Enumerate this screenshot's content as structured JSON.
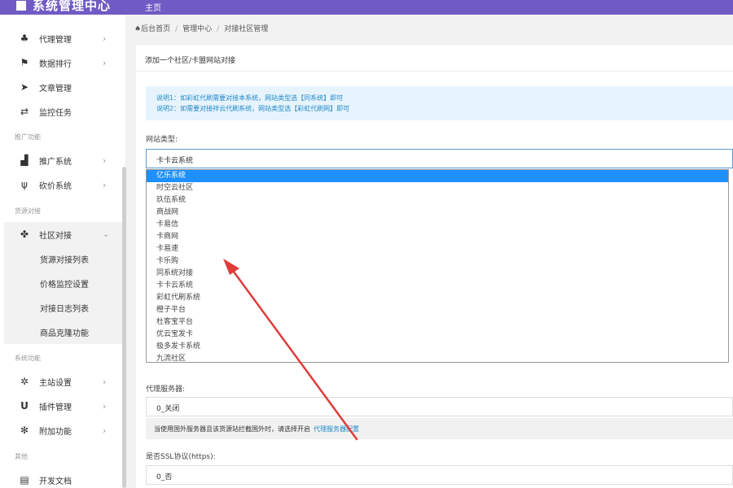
{
  "header": {
    "brand": "系统管理中心",
    "top_tab": "主页"
  },
  "sidebar": {
    "items": [
      {
        "icon": "sitemap-icon",
        "glyph": "♣",
        "label": "代理管理",
        "arrow": "›"
      },
      {
        "icon": "flag-icon",
        "glyph": "⚑",
        "label": "数据排行",
        "arrow": "›"
      },
      {
        "icon": "send-icon",
        "glyph": "➤",
        "label": "文章管理",
        "arrow": ""
      },
      {
        "icon": "exchange-icon",
        "glyph": "⇄",
        "label": "监控任务",
        "arrow": ""
      }
    ],
    "section_promo": "推广功能",
    "promo_items": [
      {
        "icon": "chart-icon",
        "glyph": "▟",
        "label": "推广系统",
        "arrow": "›"
      },
      {
        "icon": "cutlery-icon",
        "glyph": "ψ",
        "label": "砍价系统",
        "arrow": "›"
      }
    ],
    "section_source": "货源对接",
    "open_item": {
      "icon": "cubes-icon",
      "glyph": "✤",
      "label": "社区对接",
      "arrow": "⌄"
    },
    "sub_items": [
      "货源对接列表",
      "价格监控设置",
      "对接日志列表",
      "商品克隆功能"
    ],
    "section_system": "系统功能",
    "system_items": [
      {
        "icon": "gear-icon",
        "glyph": "✲",
        "label": "主站设置",
        "arrow": "›"
      },
      {
        "icon": "magnet-icon",
        "glyph": "U",
        "label": "插件管理",
        "arrow": "›"
      },
      {
        "icon": "cogs-icon",
        "glyph": "✻",
        "label": "附加功能",
        "arrow": "›"
      }
    ],
    "section_other": "其他",
    "other_items": [
      {
        "icon": "document-icon",
        "glyph": "▤",
        "label": "开发文档",
        "arrow": ""
      }
    ]
  },
  "breadcrumb": {
    "home": "后台首页",
    "sep": "/",
    "level1": "管理中心",
    "level2": "对接社区管理"
  },
  "card": {
    "title": "添加一个社区/卡盟网站对接",
    "tip_line1": "说明1：如彩虹代刷需要对接本系统，网站类型选【同系统】即可",
    "tip_line2": "说明2：如需要对接祥云代刷系统，网站类型选【彩虹代刷网】即可",
    "site_type_label": "网站类型:",
    "site_type_value": "卡卡云系统",
    "proxy_label": "代理服务器:",
    "proxy_value": "0_关闭",
    "proxy_help": "当使用国外服务器且该货源站拦截国外时，请选择开启",
    "proxy_help_link": "代理服务器配置",
    "ssl_label": "是否SSL协议(https):",
    "ssl_value": "0_否"
  },
  "dropdown": {
    "selected_index": 0,
    "options": [
      "亿乐系统",
      "时空云社区",
      "玖伍系统",
      "商战网",
      "卡易信",
      "卡商网",
      "卡易速",
      "卡乐购",
      "同系统对接",
      "卡卡云系统",
      "彩虹代刷系统",
      "橙子平台",
      "杜客宝平台",
      "优云宝发卡",
      "极多发卡系统",
      "九流社区"
    ]
  },
  "colors": {
    "topbar": "#6f5bc4",
    "selected": "#1e90ff",
    "link": "#1e88c8",
    "annotation_arrow": "#e03c3c"
  }
}
